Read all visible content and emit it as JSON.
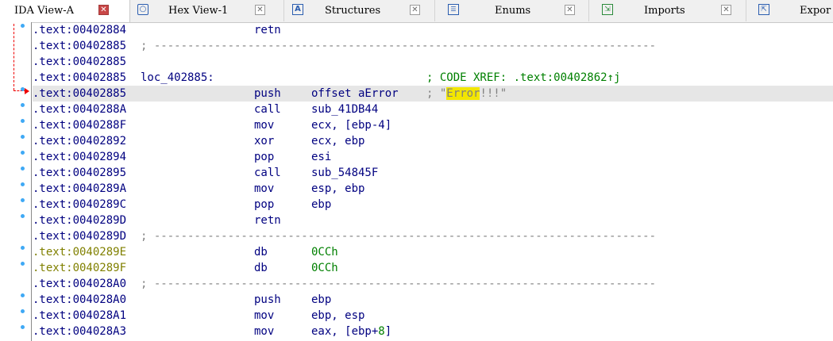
{
  "tabs": [
    {
      "label": "IDA View-A",
      "icon": "ida-view-icon",
      "active": true
    },
    {
      "label": "Hex View-1",
      "icon": "hex-view-icon",
      "active": false
    },
    {
      "label": "Structures",
      "icon": "structures-icon",
      "active": false
    },
    {
      "label": "Enums",
      "icon": "enums-icon",
      "active": false
    },
    {
      "label": "Imports",
      "icon": "imports-icon",
      "active": false
    },
    {
      "label": "Expor",
      "icon": "exports-icon",
      "active": false
    }
  ],
  "colors": {
    "address": "#000080",
    "data_address": "#808000",
    "number": "#008000",
    "comment": "#808080",
    "highlight": "#f2e600",
    "current_line": "#e6e6e6",
    "jump_arrow": "#ee0000",
    "dot": "#3fa9f5"
  },
  "lines": [
    {
      "addr": ".text:00402884",
      "mnem": "retn"
    },
    {
      "addr": ".text:00402885",
      "sep": "; ---------------------------------------------------------------------------"
    },
    {
      "addr": ".text:00402885"
    },
    {
      "addr": ".text:00402885",
      "label": "loc_402885:",
      "comment": "; CODE XREF: .text:00402862↑j"
    },
    {
      "addr": ".text:00402885",
      "mnem": "push",
      "op": "offset aError",
      "comment_pre": "; \"",
      "comment_hl": "Error",
      "comment_post": "!!!\""
    },
    {
      "addr": ".text:0040288A",
      "mnem": "call",
      "op": "sub_41DB44"
    },
    {
      "addr": ".text:0040288F",
      "mnem": "mov",
      "op": "ecx, [ebp-4]"
    },
    {
      "addr": ".text:00402892",
      "mnem": "xor",
      "op": "ecx, ebp"
    },
    {
      "addr": ".text:00402894",
      "mnem": "pop",
      "op": "esi"
    },
    {
      "addr": ".text:00402895",
      "mnem": "call",
      "op": "sub_54845F"
    },
    {
      "addr": ".text:0040289A",
      "mnem": "mov",
      "op": "esp, ebp"
    },
    {
      "addr": ".text:0040289C",
      "mnem": "pop",
      "op": "ebp"
    },
    {
      "addr": ".text:0040289D",
      "mnem": "retn"
    },
    {
      "addr": ".text:0040289D",
      "sep": "; ---------------------------------------------------------------------------"
    },
    {
      "addr": ".text:0040289E",
      "mnem": "db",
      "op_num": "0CCh",
      "data": true
    },
    {
      "addr": ".text:0040289F",
      "mnem": "db",
      "op_num": "0CCh",
      "data": true
    },
    {
      "addr": ".text:004028A0",
      "sep": "; ---------------------------------------------------------------------------"
    },
    {
      "addr": ".text:004028A0",
      "mnem": "push",
      "op": "ebp"
    },
    {
      "addr": ".text:004028A1",
      "mnem": "mov",
      "op": "ebp, esp"
    },
    {
      "addr": ".text:004028A3",
      "mnem": "mov",
      "op": "eax, [ebp+",
      "op_num": "8",
      "op_post": "]"
    }
  ]
}
